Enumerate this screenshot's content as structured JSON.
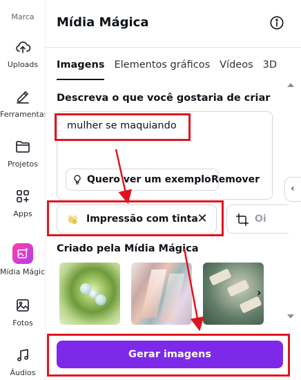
{
  "rail": {
    "top_label": "Marca",
    "items": [
      {
        "label": "Uploads",
        "icon": "cloud-upload-icon"
      },
      {
        "label": "Ferramentas",
        "icon": "pencil-tool-icon"
      },
      {
        "label": "Projetos",
        "icon": "folder-icon"
      },
      {
        "label": "Apps",
        "icon": "apps-grid-icon"
      },
      {
        "label": "Mídia Mágica",
        "icon": "magic-media-icon",
        "active": true
      },
      {
        "label": "Fotos",
        "icon": "photo-icon"
      },
      {
        "label": "Áudios",
        "icon": "music-note-icon"
      }
    ]
  },
  "panel": {
    "title": "Mídia Mágica",
    "tabs": [
      {
        "label": "Imagens",
        "active": true
      },
      {
        "label": "Elementos gráficos"
      },
      {
        "label": "Vídeos"
      },
      {
        "label": "3D"
      }
    ],
    "prompt_label": "Descreva o que você gostaria de criar",
    "prompt_value": "mulher se maquiando",
    "example_button": "Quero ver um exemplo",
    "remove_button": "Remover",
    "style_chip": "Impressão com tinta",
    "next_chip_partial": "Oi",
    "gallery_title": "Criado pela Mídia Mágica",
    "generate_button": "Gerar imagens"
  },
  "colors": {
    "accent": "#7d2ae8",
    "annotation": "#e0141e",
    "active_icon_start": "#ff3fa4",
    "active_icon_end": "#b43cf0"
  }
}
